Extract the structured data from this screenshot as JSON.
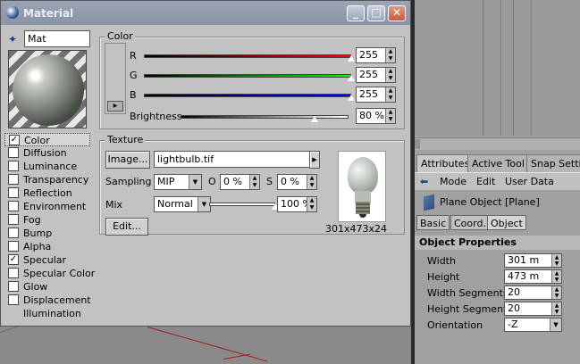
{
  "window": {
    "title": "Material"
  },
  "material": {
    "name": "Mat"
  },
  "channels": [
    {
      "label": "Color",
      "checked": true,
      "selected": true
    },
    {
      "label": "Diffusion",
      "checked": false
    },
    {
      "label": "Luminance",
      "checked": false
    },
    {
      "label": "Transparency",
      "checked": false
    },
    {
      "label": "Reflection",
      "checked": false
    },
    {
      "label": "Environment",
      "checked": false
    },
    {
      "label": "Fog",
      "checked": false
    },
    {
      "label": "Bump",
      "checked": false
    },
    {
      "label": "Alpha",
      "checked": false
    },
    {
      "label": "Specular",
      "checked": true
    },
    {
      "label": "Specular Color",
      "checked": false
    },
    {
      "label": "Glow",
      "checked": false
    },
    {
      "label": "Displacement",
      "checked": false
    },
    {
      "label": "Illumination",
      "checked": null
    }
  ],
  "color": {
    "title": "Color",
    "r": {
      "label": "R",
      "value": "255",
      "level": 1.0
    },
    "g": {
      "label": "G",
      "value": "255",
      "level": 1.0
    },
    "b": {
      "label": "B",
      "value": "255",
      "level": 1.0
    },
    "brightness": {
      "label": "Brightness",
      "value": "80 %",
      "level": 0.8
    }
  },
  "texture": {
    "title": "Texture",
    "image_button": "Image...",
    "filename": "lightbulb.tif",
    "sampling_label": "Sampling",
    "sampling_value": "MIP",
    "o_label": "O",
    "o_value": "0 %",
    "s_label": "S",
    "s_value": "0 %",
    "mix_label": "Mix",
    "mix_value": "Normal",
    "mix_amount": "100 %",
    "mix_level": 1.0,
    "edit_button": "Edit...",
    "dimensions": "301x473x24"
  },
  "attributes": {
    "tabs": [
      "Attributes",
      "Active Tool",
      "Snap Setting"
    ],
    "menu": [
      "Mode",
      "Edit",
      "User Data"
    ],
    "object_title": "Plane Object [Plane]",
    "subtabs": [
      "Basic",
      "Coord.",
      "Object"
    ],
    "section": "Object Properties",
    "props": [
      {
        "label": "Width",
        "value": "301 m"
      },
      {
        "label": "Height",
        "value": "473 m"
      },
      {
        "label": "Width Segments",
        "value": "20"
      },
      {
        "label": "Height Segments",
        "value": "20"
      },
      {
        "label": "Orientation",
        "value": "-Z"
      }
    ]
  }
}
